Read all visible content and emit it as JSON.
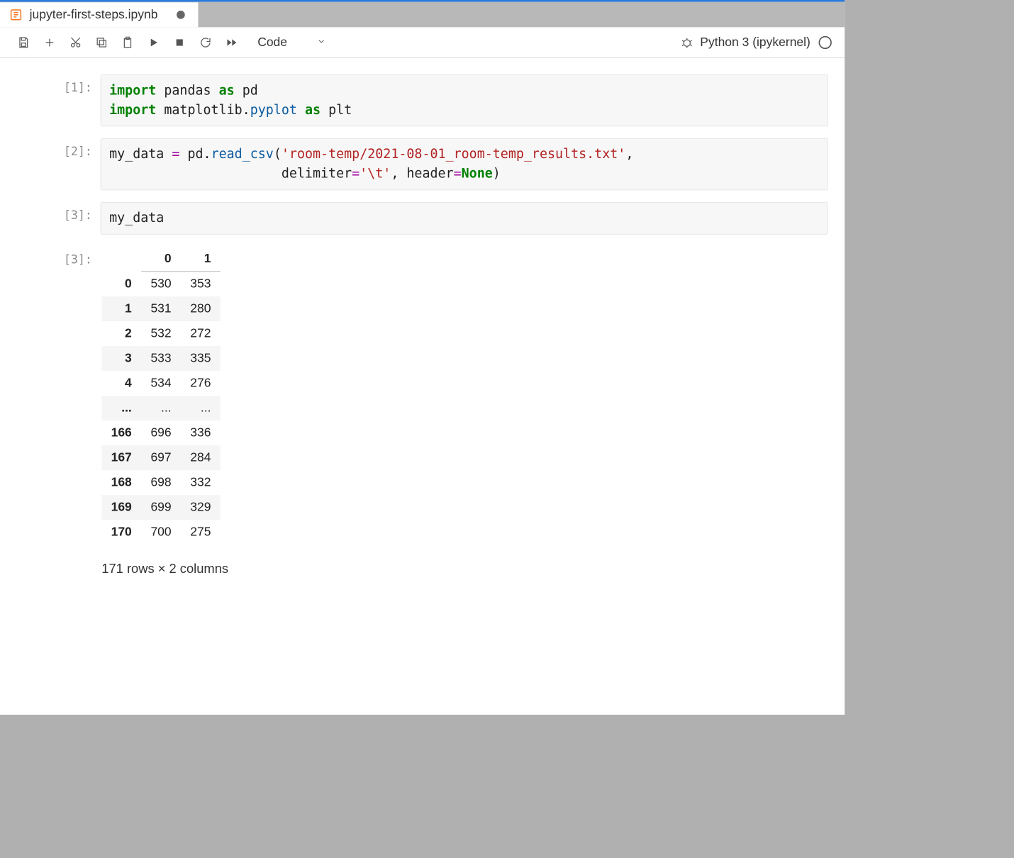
{
  "tab": {
    "filename": "jupyter-first-steps.ipynb",
    "modified": true
  },
  "toolbar": {
    "celltype_selected": "Code"
  },
  "kernel": {
    "name": "Python 3 (ipykernel)"
  },
  "cells": [
    {
      "prompt": "[1]:",
      "code_tokens": [
        {
          "t": "import",
          "c": "kw"
        },
        {
          "t": " pandas ",
          "c": ""
        },
        {
          "t": "as",
          "c": "kw"
        },
        {
          "t": " pd\n",
          "c": ""
        },
        {
          "t": "import",
          "c": "kw"
        },
        {
          "t": " matplotlib",
          "c": ""
        },
        {
          "t": ".",
          "c": ""
        },
        {
          "t": "pyplot",
          "c": "mod"
        },
        {
          "t": " ",
          "c": ""
        },
        {
          "t": "as",
          "c": "kw"
        },
        {
          "t": " plt",
          "c": ""
        }
      ]
    },
    {
      "prompt": "[2]:",
      "code_tokens": [
        {
          "t": "my_data ",
          "c": ""
        },
        {
          "t": "=",
          "c": "op"
        },
        {
          "t": " pd",
          "c": ""
        },
        {
          "t": ".",
          "c": ""
        },
        {
          "t": "read_csv",
          "c": "fn"
        },
        {
          "t": "(",
          "c": ""
        },
        {
          "t": "'room-temp/2021-08-01_room-temp_results.txt'",
          "c": "str"
        },
        {
          "t": ",\n",
          "c": ""
        },
        {
          "t": "                      delimiter",
          "c": ""
        },
        {
          "t": "=",
          "c": "op"
        },
        {
          "t": "'\\t'",
          "c": "str"
        },
        {
          "t": ", header",
          "c": ""
        },
        {
          "t": "=",
          "c": "op"
        },
        {
          "t": "None",
          "c": "const"
        },
        {
          "t": ")",
          "c": ""
        }
      ]
    },
    {
      "prompt": "[3]:",
      "code_tokens": [
        {
          "t": "my_data",
          "c": ""
        }
      ]
    }
  ],
  "output": {
    "prompt": "[3]:",
    "columns": [
      "",
      "0",
      "1"
    ],
    "rows": [
      {
        "idx": "0",
        "col0": "530",
        "col1": "353"
      },
      {
        "idx": "1",
        "col0": "531",
        "col1": "280"
      },
      {
        "idx": "2",
        "col0": "532",
        "col1": "272"
      },
      {
        "idx": "3",
        "col0": "533",
        "col1": "335"
      },
      {
        "idx": "4",
        "col0": "534",
        "col1": "276"
      },
      {
        "idx": "...",
        "col0": "...",
        "col1": "..."
      },
      {
        "idx": "166",
        "col0": "696",
        "col1": "336"
      },
      {
        "idx": "167",
        "col0": "697",
        "col1": "284"
      },
      {
        "idx": "168",
        "col0": "698",
        "col1": "332"
      },
      {
        "idx": "169",
        "col0": "699",
        "col1": "329"
      },
      {
        "idx": "170",
        "col0": "700",
        "col1": "275"
      }
    ],
    "shape_text": "171 rows × 2 columns"
  }
}
